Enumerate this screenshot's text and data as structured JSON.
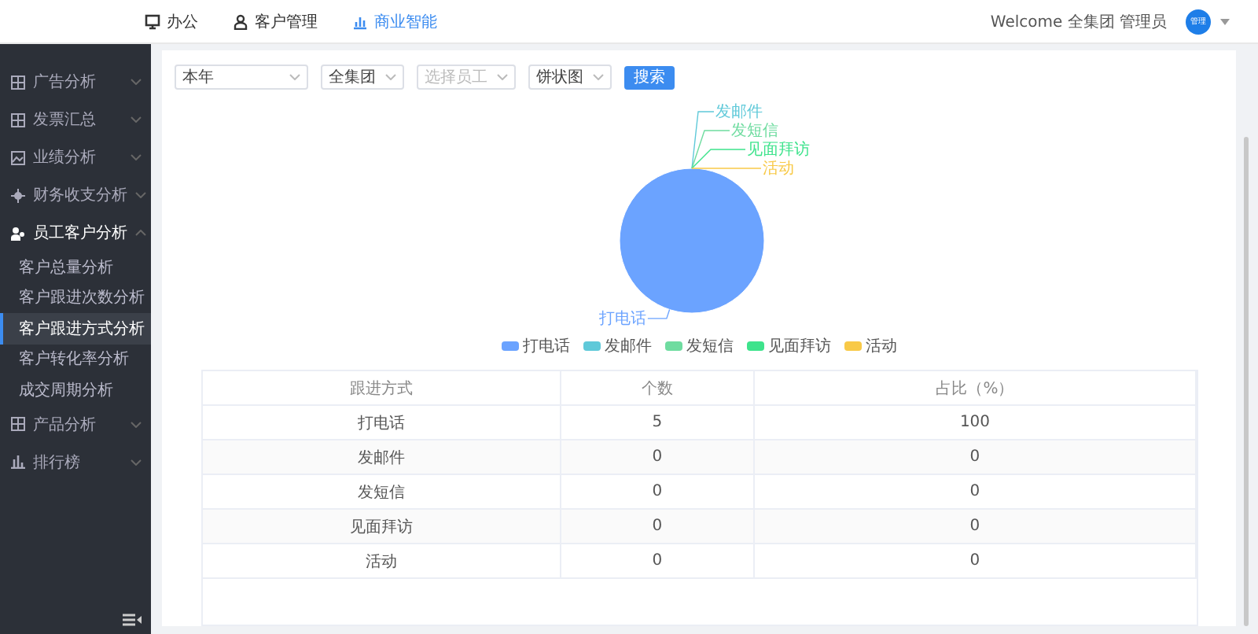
{
  "top_nav": {
    "items": [
      {
        "label": "办公",
        "selected": false
      },
      {
        "label": "客户管理",
        "selected": false
      },
      {
        "label": "商业智能",
        "selected": true
      }
    ],
    "welcome": "Welcome 全集团 管理员",
    "avatar": "管理"
  },
  "sidebar": {
    "items": [
      {
        "label": "广告分析",
        "expanded": false
      },
      {
        "label": "发票汇总",
        "expanded": false
      },
      {
        "label": "业绩分析",
        "expanded": false
      },
      {
        "label": "财务收支分析",
        "expanded": false
      },
      {
        "label": "员工客户分析",
        "expanded": true,
        "children": [
          {
            "label": "客户总量分析",
            "selected": false
          },
          {
            "label": "客户跟进次数分析",
            "selected": false
          },
          {
            "label": "客户跟进方式分析",
            "selected": true
          },
          {
            "label": "客户转化率分析",
            "selected": false
          },
          {
            "label": "成交周期分析",
            "selected": false
          }
        ]
      },
      {
        "label": "产品分析",
        "expanded": false
      },
      {
        "label": "排行榜",
        "expanded": false
      }
    ]
  },
  "filters": [
    {
      "value": "本年"
    },
    {
      "value": "全集团"
    },
    {
      "placeholder": "选择员工"
    },
    {
      "value": "饼状图"
    }
  ],
  "search_button": "搜索",
  "chart_data": {
    "type": "pie",
    "categories": [
      "打电话",
      "发邮件",
      "发短信",
      "见面拜访",
      "活动"
    ],
    "values": [
      100,
      0,
      0,
      0,
      0
    ],
    "colors": [
      "#6ba3ff",
      "#5fc9d9",
      "#6fdca0",
      "#3ee38c",
      "#f8c947"
    ]
  },
  "table": {
    "columns": [
      "跟进方式",
      "个数",
      "占比（%）"
    ],
    "rows": [
      [
        "打电话",
        "5",
        "100"
      ],
      [
        "发邮件",
        "0",
        "0"
      ],
      [
        "发短信",
        "0",
        "0"
      ],
      [
        "见面拜访",
        "0",
        "0"
      ],
      [
        "活动",
        "0",
        "0"
      ]
    ]
  }
}
